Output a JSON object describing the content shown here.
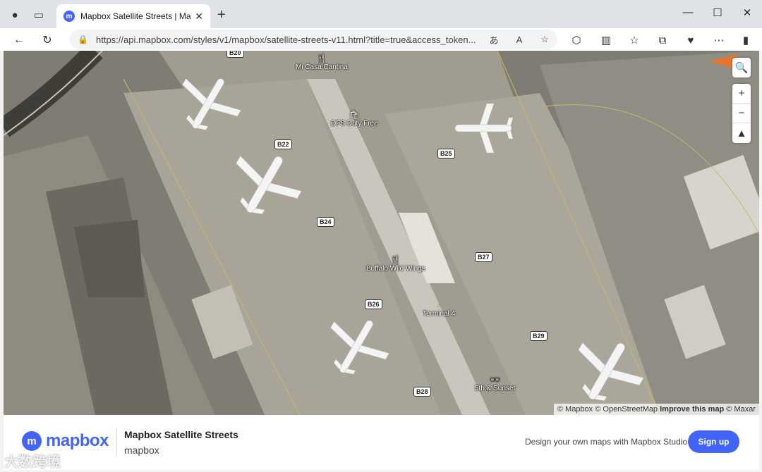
{
  "browser": {
    "tab_title": "Mapbox Satellite Streets | Mapbox",
    "url": "https://api.mapbox.com/styles/v1/mapbox/satellite-streets-v11.html?title=true&access_token..."
  },
  "map": {
    "gates": [
      {
        "label": "B20"
      },
      {
        "label": "B22"
      },
      {
        "label": "B25"
      },
      {
        "label": "B24"
      },
      {
        "label": "B27"
      },
      {
        "label": "B26"
      },
      {
        "label": "B29"
      },
      {
        "label": "B28"
      }
    ],
    "pois": [
      {
        "label": "Mi Casa Cantina",
        "icon": "fork-knife-icon"
      },
      {
        "label": "DFS Duty Free",
        "icon": "shop-icon"
      },
      {
        "label": "Buffalo Wild Wings",
        "icon": "fork-knife-icon"
      },
      {
        "label": "Terminal 4",
        "icon": "dot-icon"
      },
      {
        "label": "5th & Sunset",
        "icon": "glasses-icon"
      }
    ],
    "attribution": {
      "mapbox": "© Mapbox",
      "osm": "© OpenStreetMap",
      "improve": "Improve this map",
      "maxar": "© Maxar"
    }
  },
  "footer": {
    "logo_text": "mapbox",
    "title": "Mapbox Satellite Streets",
    "subtitle": "mapbox",
    "design_text": "Design your own maps with Mapbox Studio",
    "signup_label": "Sign up"
  },
  "watermark": "大数跨境",
  "colors": {
    "accent": "#4264fb"
  }
}
